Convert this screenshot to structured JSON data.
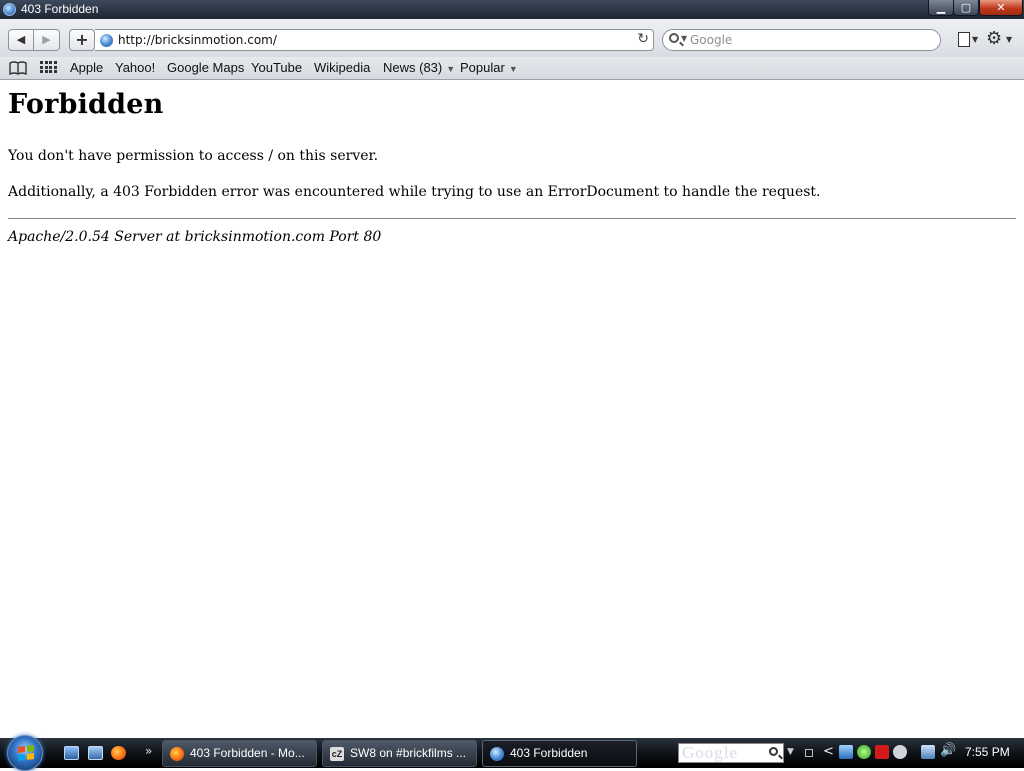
{
  "window": {
    "title": "403 Forbidden",
    "controls": {
      "minimize": "▁",
      "maximize": "▢",
      "close": "✕"
    }
  },
  "toolbar": {
    "back_icon": "◀",
    "forward_icon": "▶",
    "add_bookmark_icon": "+",
    "url": "http://bricksinmotion.com/",
    "reload_icon": "↻",
    "search_placeholder": "Google",
    "page_menu_icon": "page-icon",
    "settings_menu_icon": "gear-icon",
    "gear_glyph": "⚙",
    "dropdown_glyph": "▼"
  },
  "bookmarks": {
    "items": [
      {
        "label": "Apple"
      },
      {
        "label": "Yahoo!"
      },
      {
        "label": "Google Maps"
      },
      {
        "label": "YouTube"
      },
      {
        "label": "Wikipedia"
      },
      {
        "label": "News (83)",
        "dropdown": true
      },
      {
        "label": "Popular",
        "dropdown": true
      }
    ],
    "dropdown_glyph": "▼"
  },
  "page": {
    "heading": "Forbidden",
    "paragraph1": "You don't have permission to access / on this server.",
    "paragraph2": "Additionally, a 403 Forbidden error was encountered while trying to use an ErrorDocument to handle the request.",
    "server_signature": "Apache/2.0.54 Server at bricksinmotion.com Port 80"
  },
  "taskbar": {
    "quick_launch_more": "»",
    "tasks": [
      {
        "label": "403 Forbidden - Mo...",
        "icon": "firefox-icon"
      },
      {
        "label": "SW8 on #brickfilms ...",
        "icon": "chatzilla-icon",
        "icon_text": "cZ"
      },
      {
        "label": "403 Forbidden",
        "icon": "safari-icon",
        "active": true
      }
    ],
    "search_logo": "Google",
    "tray_chevron": "<",
    "volume_glyph": "🔊",
    "clock": "7:55 PM"
  },
  "colors": {
    "titlebar": "#1c2533",
    "close_button": "#c1391b",
    "taskbar": "#0c0f14",
    "page_background": "#ffffff"
  }
}
